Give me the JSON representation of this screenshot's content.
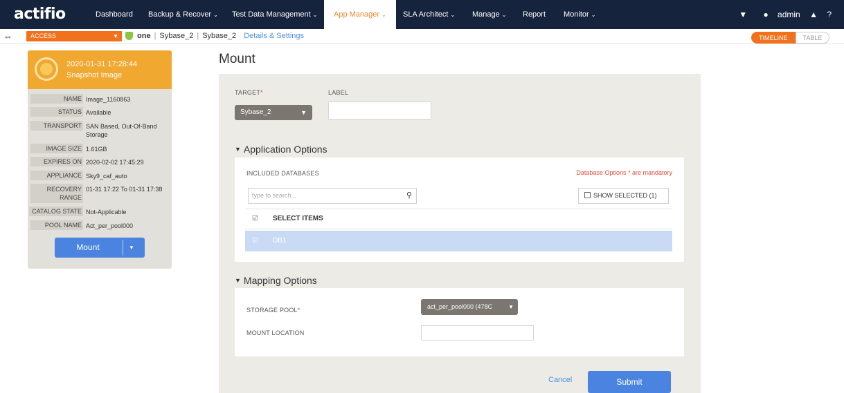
{
  "nav": {
    "logo": "actifio",
    "items": [
      {
        "label": "Dashboard",
        "caret": ""
      },
      {
        "label": "Backup & Recover",
        "caret": "⌄"
      },
      {
        "label": "Test Data Management",
        "caret": "⌄"
      },
      {
        "label": "App Manager",
        "caret": "⌄"
      },
      {
        "label": "SLA Architect",
        "caret": "⌄"
      },
      {
        "label": "Manage",
        "caret": "⌄"
      },
      {
        "label": "Report",
        "caret": ""
      },
      {
        "label": "Monitor",
        "caret": "⌄"
      }
    ],
    "user": "admin",
    "accent": "#f08a2c",
    "bg": "#15243c"
  },
  "breadcrumb": {
    "access": "ACCESS",
    "appliance": "one",
    "host": "Sybase_2",
    "app": "Sybase_2",
    "details_link": "Details & Settings"
  },
  "view_toggle": {
    "timeline": "TIMELINE",
    "table": "TABLE"
  },
  "image": {
    "datetime": "2020-01-31  17:28:44",
    "type": "Snapshot Image",
    "props": [
      {
        "key": "NAME",
        "value": "Image_1160863"
      },
      {
        "key": "STATUS",
        "value": "Available"
      },
      {
        "key": "TRANSPORT",
        "value": "SAN Based, Out-Of-Band Storage"
      },
      {
        "key": "IMAGE SIZE",
        "value": "1.61GB"
      },
      {
        "key": "EXPIRES ON",
        "value": "2020-02-02 17:45:29"
      },
      {
        "key": "APPLIANCE",
        "value": "Sky9_caf_auto"
      },
      {
        "key": "RECOVERY RANGE",
        "value": "01-31 17:22 To 01-31 17:38"
      },
      {
        "key": "CATALOG STATE",
        "value": "Not-Applicable"
      },
      {
        "key": "POOL NAME",
        "value": "Act_per_pool000"
      }
    ],
    "mount_label": "Mount"
  },
  "form": {
    "title": "Mount",
    "target_label": "TARGET",
    "target_value": "Sybase_2",
    "label_label": "LABEL",
    "label_value": "",
    "app_options": "Application Options",
    "included_db": "INCLUDED DATABASES",
    "mandatory_note": "Database Options * are mandatory",
    "search_placeholder": "type to search...",
    "show_selected": "SHOW SELECTED (1)",
    "select_items": "SELECT ITEMS",
    "db_row": "DB1",
    "mapping_options": "Mapping Options",
    "storage_pool_label": "STORAGE POOL",
    "storage_pool_value": "act_per_pool000 (478C",
    "mount_location_label": "MOUNT LOCATION",
    "mount_location_value": "",
    "cancel": "Cancel",
    "submit": "Submit"
  }
}
